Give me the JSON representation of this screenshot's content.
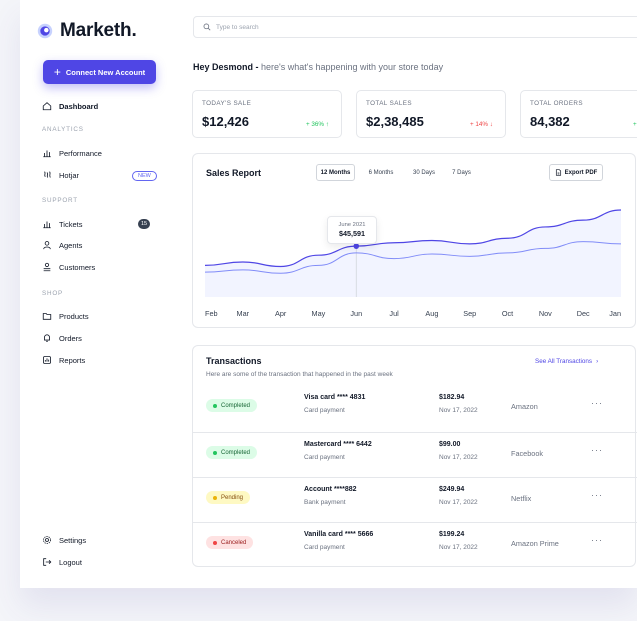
{
  "app": {
    "logo_text": "Marketh."
  },
  "sidebar": {
    "connect_label": "Connect New Account",
    "dashboard": "Dashboard",
    "sections": {
      "analytics": "ANALYTICS",
      "support": "SUPPORT",
      "shop": "SHOP"
    },
    "performance": "Performance",
    "hotjar": "Hotjar",
    "hotjar_badge": "NEW",
    "tickets": "Tickets",
    "tickets_count": "15",
    "agents": "Agents",
    "customers": "Customers",
    "products": "Products",
    "orders": "Orders",
    "reports": "Reports",
    "settings": "Settings",
    "logout": "Logout"
  },
  "search": {
    "placeholder": "Type to search"
  },
  "greeting": {
    "name": "Hey Desmond -",
    "text": "here's what's happening with your store today"
  },
  "stats": [
    {
      "label": "TODAY'S SALE",
      "value": "$12,426",
      "change": "+ 36% ↑",
      "trend": "up"
    },
    {
      "label": "TOTAL SALES",
      "value": "$2,38,485",
      "change": "+ 14% ↓",
      "trend": "down"
    },
    {
      "label": "TOTAL ORDERS",
      "value": "84,382",
      "change": "+",
      "trend": "up"
    }
  ],
  "sales_report": {
    "title": "Sales Report",
    "tabs": [
      "12 Months",
      "6 Months",
      "30 Days",
      "7 Days"
    ],
    "active_tab": "12 Months",
    "export_label": "Export PDF",
    "tooltip": {
      "date": "June 2021",
      "value": "$45,591"
    }
  },
  "chart_data": {
    "type": "line",
    "title": "Sales Report",
    "categories": [
      "Feb",
      "Mar",
      "Apr",
      "May",
      "Jun",
      "Jul",
      "Aug",
      "Sep",
      "Oct",
      "Nov",
      "Dec",
      "Jan"
    ],
    "series": [
      {
        "values": [
          28,
          31,
          27,
          37,
          45,
          48,
          50,
          47,
          52,
          62,
          68,
          77
        ]
      },
      {
        "values": [
          22,
          24,
          21,
          28,
          39,
          34,
          38,
          36,
          39,
          43,
          49,
          47
        ]
      }
    ],
    "ylim": [
      0,
      100
    ],
    "grid": false,
    "highlight": {
      "category": "Jun",
      "value": 45591,
      "label": "June 2021"
    },
    "colors": [
      "#4f46e5",
      "#818cf8"
    ]
  },
  "transactions": {
    "title": "Transactions",
    "subtitle": "Here are some of the transaction that happened in the past week",
    "see_all": "See All Transactions",
    "rows": [
      {
        "status": "Completed",
        "card": "Visa card  **** 4831",
        "type": "Card payment",
        "amount": "$182.94",
        "date": "Nov 17, 2022",
        "merchant": "Amazon"
      },
      {
        "status": "Completed",
        "card": "Mastercard  **** 6442",
        "type": "Card payment",
        "amount": "$99.00",
        "date": "Nov 17, 2022",
        "merchant": "Facebook"
      },
      {
        "status": "Pending",
        "card": "Account  ****882",
        "type": "Bank payment",
        "amount": "$249.94",
        "date": "Nov 17, 2022",
        "merchant": "Netflix"
      },
      {
        "status": "Canceled",
        "card": "Vanilla card  **** 5666",
        "type": "Card payment",
        "amount": "$199.24",
        "date": "Nov 17, 2022",
        "merchant": "Amazon Prime"
      }
    ]
  },
  "colors": {
    "accent": "#4f46e5",
    "positive": "#22c55e",
    "negative": "#ef4444"
  }
}
